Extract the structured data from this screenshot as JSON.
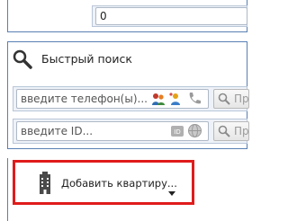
{
  "top_field": {
    "value": "0"
  },
  "quick_search": {
    "title": "Быстрый поиск",
    "phone_placeholder": "введите телефон(ы)...",
    "id_placeholder": "введите ID...",
    "search_button_label_1": "Пр",
    "search_button_label_2": "Пр"
  },
  "add_apartment": {
    "label": "Добавить квартиру..."
  },
  "colors": {
    "highlight": "#e01b1b",
    "accent": "#5a7fb3"
  }
}
